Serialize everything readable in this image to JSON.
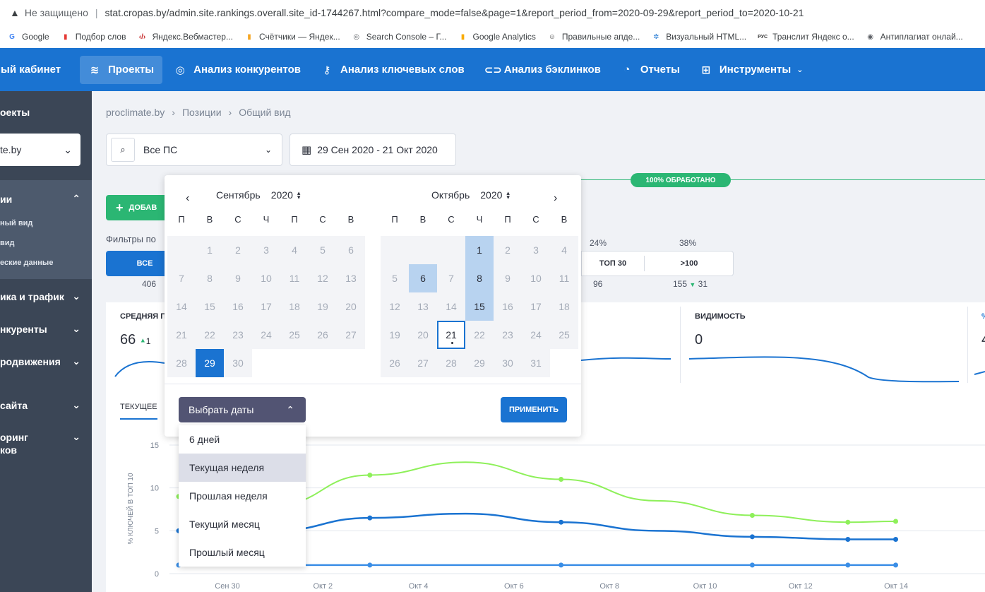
{
  "browser": {
    "security": "Не защищено",
    "url": "stat.cropas.by/admin.site.rankings.overall.site_id-1744267.html?compare_mode=false&page=1&report_period_from=2020-09-29&report_period_to=2020-10-21",
    "bookmarks": [
      "Google",
      "Подбор слов",
      "Яндекс.Вебмастер...",
      "Счётчики — Яндек...",
      "Search Console – Г...",
      "Google Analytics",
      "Правильные апде...",
      "Визуальный HTML...",
      "Транслит Яндекс о...",
      "Антиплагиат онлай..."
    ]
  },
  "topbar": {
    "brand": "ный кабинет",
    "items": [
      "Проекты",
      "Анализ конкурентов",
      "Анализ ключевых слов",
      "Анализ бэклинков",
      "Отчеты",
      "Инструменты"
    ]
  },
  "sidebar": {
    "title": "оекты",
    "project": "te.by",
    "group": "ии",
    "subs": [
      "ный вид",
      "вид",
      "еские данные"
    ],
    "rows": [
      "ика и трафик",
      "нкуренты",
      "родвижения",
      "сайта",
      "оринг",
      "ков"
    ]
  },
  "breadcrumb": [
    "proclimate.by",
    "Позиции",
    "Общий вид"
  ],
  "filter": {
    "engine": "Все ПС",
    "period": "29 Сен 2020 - 21 Окт 2020"
  },
  "add_button": "ДОБАВ",
  "filters_label": "Фильтры по",
  "tabs": {
    "all": "ВСЕ",
    "top30": "ТОП 30",
    "over100": ">100"
  },
  "counts": {
    "all": "406",
    "top30": "96",
    "over100": "155",
    "over100_delta": "31"
  },
  "pcts": {
    "top30": "24%",
    "over100": "38%"
  },
  "progress_badge": "100% ОБРАБОТАНО",
  "cards": {
    "avg_title": "СРЕДНЯЯ П",
    "avg_value": "66",
    "avg_delta": "1",
    "vis_title": "ВИДИМОСТЬ",
    "vis_value": "0",
    "right_title": "%",
    "right_value": "4"
  },
  "chart_tab": "ТЕКУЩЕЕ",
  "calendar": {
    "left": {
      "month": "Сентябрь",
      "year": "2020"
    },
    "right": {
      "month": "Октябрь",
      "year": "2020"
    },
    "weekdays": [
      "П",
      "В",
      "С",
      "Ч",
      "П",
      "С",
      "В"
    ],
    "select_label": "Выбрать даты",
    "apply_label": "ПРИМЕНИТЬ",
    "presets": [
      "6 дней",
      "Текущая неделя",
      "Прошлая неделя",
      "Текущий месяц",
      "Прошлый месяц"
    ]
  },
  "chart_data": {
    "type": "line",
    "ylabel": "% КЛЮЧЕЙ В ТОП 10",
    "yticks": [
      "15",
      "10",
      "5",
      "0"
    ],
    "ylim": [
      0,
      15
    ],
    "categories": [
      "Сен 30",
      "Окт 2",
      "Окт 4",
      "Окт 6",
      "Окт 8",
      "Окт 10",
      "Окт 12",
      "Окт 14"
    ],
    "x": [
      0,
      2,
      4,
      6,
      8,
      10,
      12,
      14,
      15
    ],
    "series": [
      {
        "color": "#8ef05a",
        "values": [
          9,
          8,
          11.5,
          13,
          11,
          8.5,
          6.8,
          6,
          6.1
        ]
      },
      {
        "color": "#1a73d1",
        "values": [
          5,
          5,
          6.5,
          7,
          6,
          5,
          4.3,
          4,
          4
        ]
      },
      {
        "color": "#3a8ee6",
        "values": [
          1,
          1,
          1,
          1,
          1,
          1,
          1,
          1,
          1
        ]
      }
    ]
  }
}
